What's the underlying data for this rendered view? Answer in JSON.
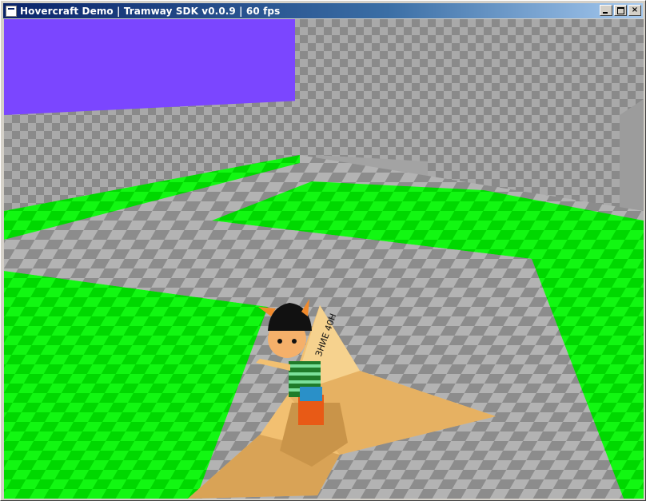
{
  "window": {
    "title": "Hovercraft Demo | Tramway SDK v0.0.9 | 60 fps"
  },
  "scene": {
    "sky_color": "#7b46ff",
    "floor_green": "#00f000",
    "floor_grey": "#9a9a9a",
    "kite_color": "#f2c071",
    "kite_text": "ЗНИЕ 40Н"
  }
}
